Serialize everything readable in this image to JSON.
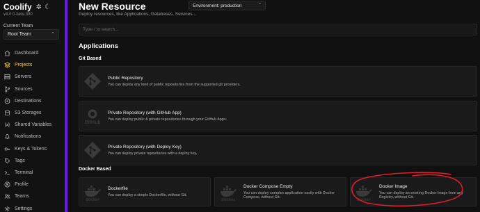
{
  "app": {
    "name": "Coolify",
    "version": "v4.0.0-beta.390"
  },
  "sidebar": {
    "team_label": "Current Team",
    "team_value": "Root Team",
    "items": [
      {
        "label": "Dashboard",
        "icon": "home-icon",
        "active": false
      },
      {
        "label": "Projects",
        "icon": "layers-icon",
        "active": true
      },
      {
        "label": "Servers",
        "icon": "server-icon",
        "active": false
      },
      {
        "label": "Sources",
        "icon": "git-branch-icon",
        "active": false
      },
      {
        "label": "Destinations",
        "icon": "destination-icon",
        "active": false
      },
      {
        "label": "S3 Storages",
        "icon": "database-icon",
        "active": false
      },
      {
        "label": "Shared Variables",
        "icon": "variable-icon",
        "active": false
      },
      {
        "label": "Notifications",
        "icon": "bell-icon",
        "active": false
      },
      {
        "label": "Keys & Tokens",
        "icon": "key-icon",
        "active": false
      },
      {
        "label": "Tags",
        "icon": "tag-icon",
        "active": false
      },
      {
        "label": "Terminal",
        "icon": "terminal-icon",
        "active": false
      },
      {
        "label": "Profile",
        "icon": "user-icon",
        "active": false
      },
      {
        "label": "Teams",
        "icon": "users-icon",
        "active": false
      },
      {
        "label": "Settings",
        "icon": "settings-icon",
        "active": false
      }
    ]
  },
  "header": {
    "title": "New Resource",
    "environment": "Environment: production",
    "subtitle": "Deploy resources, like Applications, Databases, Services..."
  },
  "search": {
    "placeholder": "Type / to search..."
  },
  "applications": {
    "title": "Applications",
    "git_based": {
      "title": "Git Based",
      "cards": [
        {
          "title": "Public Repository",
          "description": "You can deploy any kind of public repositories from the supported git providers.",
          "icon": "git-icon"
        },
        {
          "title": "Private Repository (with GitHub App)",
          "description": "You can deploy public & private repositories through your GitHub Apps.",
          "icon": "github-icon"
        },
        {
          "title": "Private Repository (with Deploy Key)",
          "description": "You can deploy private repositories with a deploy key.",
          "icon": "git-icon"
        }
      ]
    },
    "docker_based": {
      "title": "Docker Based",
      "cards": [
        {
          "title": "Dockerfile",
          "description": "You can deploy a simple Dockerfile, without Git.",
          "icon": "docker-icon",
          "logo_text": "docker"
        },
        {
          "title": "Docker Compose Empty",
          "description": "You can deploy complex application easily with Docker Compose, without Git.",
          "icon": "docker-icon",
          "logo_text": "docker"
        },
        {
          "title": "Docker Image",
          "description": "You can deploy an existing Docker Image from any Registry, without Git.",
          "icon": "docker-icon",
          "logo_text": "docker"
        }
      ]
    }
  },
  "annotation": {
    "color": "#e11d2b",
    "shape": "hand-drawn-circle"
  }
}
